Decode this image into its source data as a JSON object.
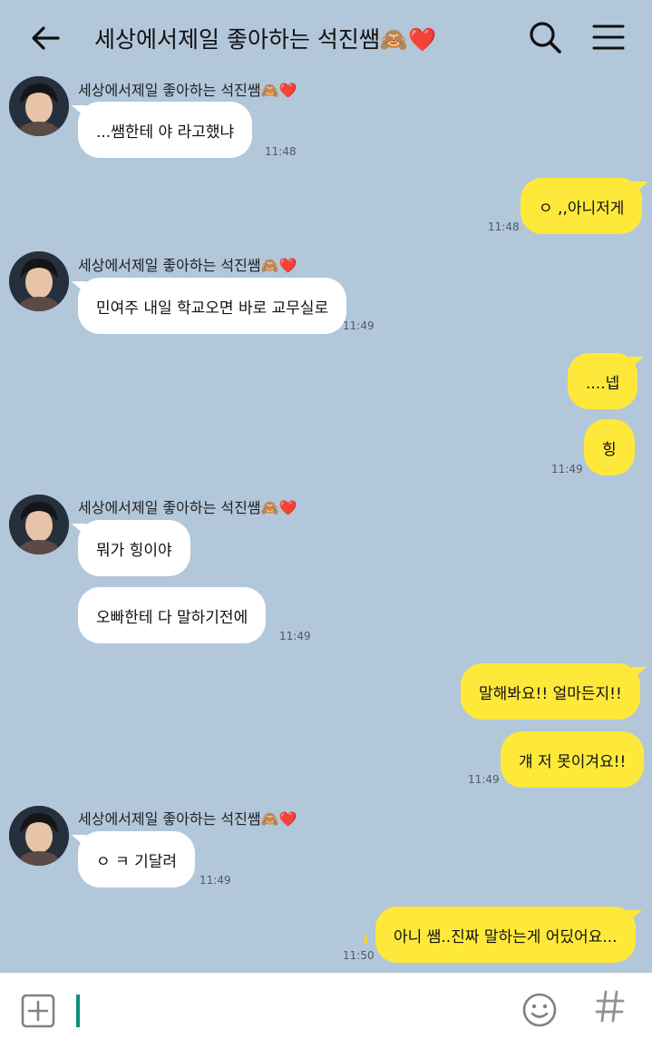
{
  "header": {
    "title": "세상에서제일 좋아하는 석진쌤🙈❤️"
  },
  "messages": {
    "g1": {
      "sender": "세상에서제일 좋아하는 석진쌤🙈❤️",
      "text": "...쌤한테 야 라고했냐",
      "time": "11:48"
    },
    "o1": {
      "text": "ㅇ ,,아니저게",
      "time": "11:48"
    },
    "g2": {
      "sender": "세상에서제일 좋아하는 석진쌤🙈❤️",
      "text": "민여주 내일 학교오면 바로 교무실로",
      "time": "11:49"
    },
    "o2": {
      "text1": "....넵",
      "text2": "힝",
      "time": "11:49"
    },
    "g3": {
      "sender": "세상에서제일 좋아하는 석진쌤🙈❤️",
      "text1": "뭐가 힝이야",
      "text2": "오빠한테 다 말하기전에",
      "time": "11:49"
    },
    "o3": {
      "text1": "말해봐요!! 얼마든지!!",
      "text2": "걔 저 못이겨요!!",
      "time": "11:49"
    },
    "g4": {
      "sender": "세상에서제일 좋아하는 석진쌤🙈❤️",
      "text": "ㅇ ㅋ  기달려",
      "time": "11:49"
    },
    "o4": {
      "text": "아니 쌤..진짜 말하는게 어딨어요...",
      "time": "11:50"
    }
  },
  "input": {
    "value": ""
  },
  "icons": {
    "back": "arrow-left-icon",
    "search": "search-icon",
    "menu": "hamburger-menu-icon",
    "attach": "plus-square-icon",
    "emoji": "emoji-smile-icon",
    "hash": "hash-icon"
  },
  "colors": {
    "background": "#b2c7da",
    "incoming_bubble": "#ffffff",
    "outgoing_bubble": "#fee93a",
    "cursor": "#0c8f7f"
  }
}
